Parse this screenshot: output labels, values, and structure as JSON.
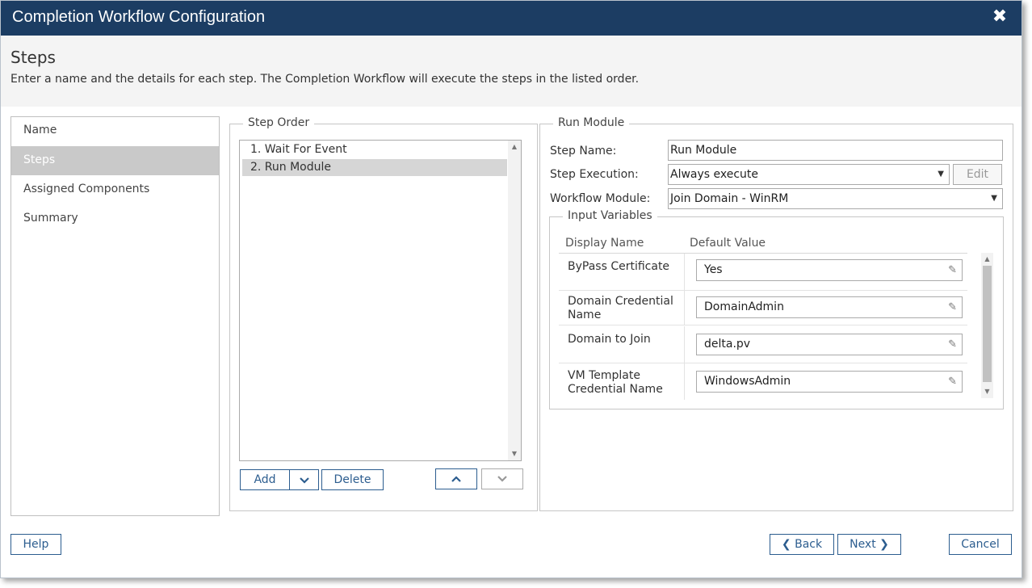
{
  "window": {
    "title": "Completion Workflow Configuration",
    "close_glyph": "✖"
  },
  "header": {
    "heading": "Steps",
    "description": "Enter a name and the details for each step. The Completion Workflow will execute the steps in the listed order."
  },
  "nav": {
    "items": [
      {
        "label": "Name"
      },
      {
        "label": "Steps"
      },
      {
        "label": "Assigned Components"
      },
      {
        "label": "Summary"
      }
    ]
  },
  "step_order": {
    "legend": "Step Order",
    "items": [
      "1. Wait For Event",
      "2. Run Module"
    ],
    "buttons": {
      "add": "Add",
      "delete": "Delete"
    }
  },
  "run_module": {
    "legend": "Run Module",
    "step_name_label": "Step Name:",
    "step_name_value": "Run Module",
    "step_execution_label": "Step Execution:",
    "step_execution_value": "Always execute",
    "edit_label": "Edit",
    "workflow_module_label": "Workflow Module:",
    "workflow_module_value": "Join Domain - WinRM",
    "input_variables": {
      "legend": "Input Variables",
      "col_display_name": "Display Name",
      "col_default_value": "Default Value",
      "rows": [
        {
          "name": "ByPass Certificate",
          "value": "Yes"
        },
        {
          "name": "Domain Credential Name",
          "value": "DomainAdmin"
        },
        {
          "name": "Domain to Join",
          "value": "delta.pv"
        },
        {
          "name": "VM Template Credential Name",
          "value": "WindowsAdmin"
        }
      ]
    }
  },
  "footer": {
    "help": "Help",
    "back": "Back",
    "next": "Next",
    "cancel": "Cancel"
  },
  "colors": {
    "titlebar": "#1c3d63",
    "accent": "#2c5d8f",
    "nav_active": "#c9c9c9"
  }
}
